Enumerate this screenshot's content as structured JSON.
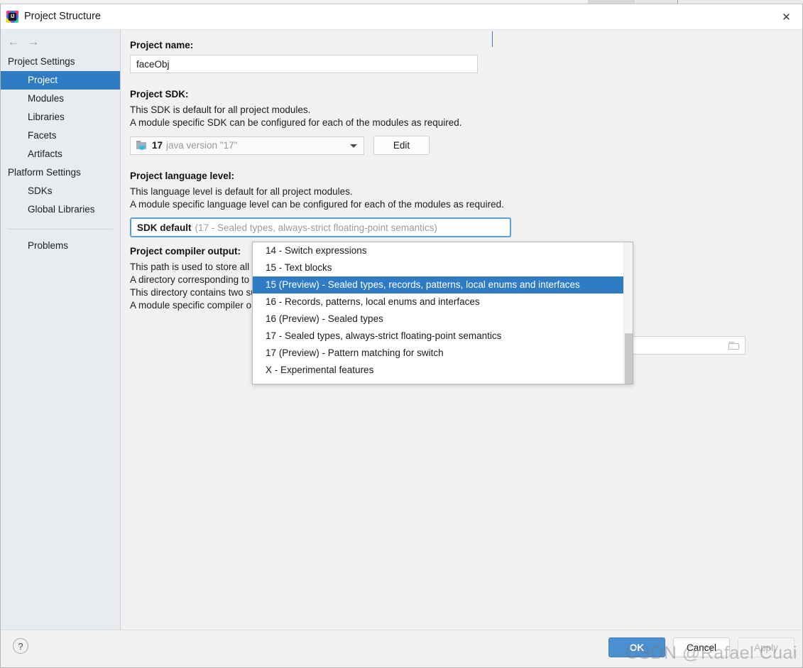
{
  "window": {
    "title": "Project Structure",
    "app_icon": "intellij-idea-icon",
    "icon_text": "IJ",
    "close_icon": "✕"
  },
  "sidebar": {
    "back_icon": "←",
    "forward_icon": "→",
    "groups": [
      {
        "title": "Project Settings",
        "items": [
          {
            "label": "Project",
            "selected": true
          },
          {
            "label": "Modules",
            "selected": false
          },
          {
            "label": "Libraries",
            "selected": false
          },
          {
            "label": "Facets",
            "selected": false
          },
          {
            "label": "Artifacts",
            "selected": false
          }
        ]
      },
      {
        "title": "Platform Settings",
        "items": [
          {
            "label": "SDKs",
            "selected": false
          },
          {
            "label": "Global Libraries",
            "selected": false
          }
        ]
      }
    ],
    "problems_label": "Problems"
  },
  "main": {
    "project_name": {
      "label": "Project name:",
      "value": "faceObj",
      "placeholder": ""
    },
    "project_sdk": {
      "label": "Project SDK:",
      "desc1": "This SDK is default for all project modules.",
      "desc2": "A module specific SDK can be configured for each of the modules as required.",
      "combo_icon": "jdk-folder-icon",
      "combo_name": "17",
      "combo_version": "java version \"17\"",
      "dropdown_icon": "chevron-down-icon",
      "edit_button": "Edit"
    },
    "project_language_level": {
      "label": "Project language level:",
      "desc1": "This language level is default for all project modules.",
      "desc2": "A module specific language level can be configured for each of the modules as required.",
      "selected_main": "SDK default",
      "selected_sub": "(17 - Sealed types, always-strict floating-point semantics)",
      "dropdown_icon": "chevron-down-icon"
    },
    "compiler_output": {
      "label": "Project compiler output:",
      "desc1": "This path is used to store all project compilation results.",
      "desc2": "A directory corresponding to each module is created under this path.",
      "desc3": "This directory contains two subdirectories: Production and Test for production code and test sources, respectively.",
      "desc4": "A module specific compiler output path can be configured for each of the modules as required.",
      "path_value": "",
      "browse_icon": "folder-icon"
    }
  },
  "dropdown": {
    "items": [
      {
        "label": "14 - Switch expressions",
        "selected": false
      },
      {
        "label": "15 - Text blocks",
        "selected": false
      },
      {
        "label": "15 (Preview) - Sealed types, records, patterns, local enums and interfaces",
        "selected": true
      },
      {
        "label": "16 - Records, patterns, local enums and interfaces",
        "selected": false
      },
      {
        "label": "16 (Preview) - Sealed types",
        "selected": false
      },
      {
        "label": "17 - Sealed types, always-strict floating-point semantics",
        "selected": false
      },
      {
        "label": "17 (Preview) - Pattern matching for switch",
        "selected": false
      },
      {
        "label": "X - Experimental features",
        "selected": false
      }
    ]
  },
  "footer": {
    "help_icon": "?",
    "ok_label": "OK",
    "cancel_label": "Cancel",
    "apply_label": "Apply"
  },
  "watermark": "CSDN @Rafael Cuai",
  "colors": {
    "accent_blue": "#2f7bc4",
    "ok_button_blue": "#4a8fd0",
    "focus_border": "#5a9fd4",
    "sidebar_bg": "#e8ecf0",
    "panel_bg": "#f1f1f1",
    "muted_text": "#9b9b9b"
  }
}
